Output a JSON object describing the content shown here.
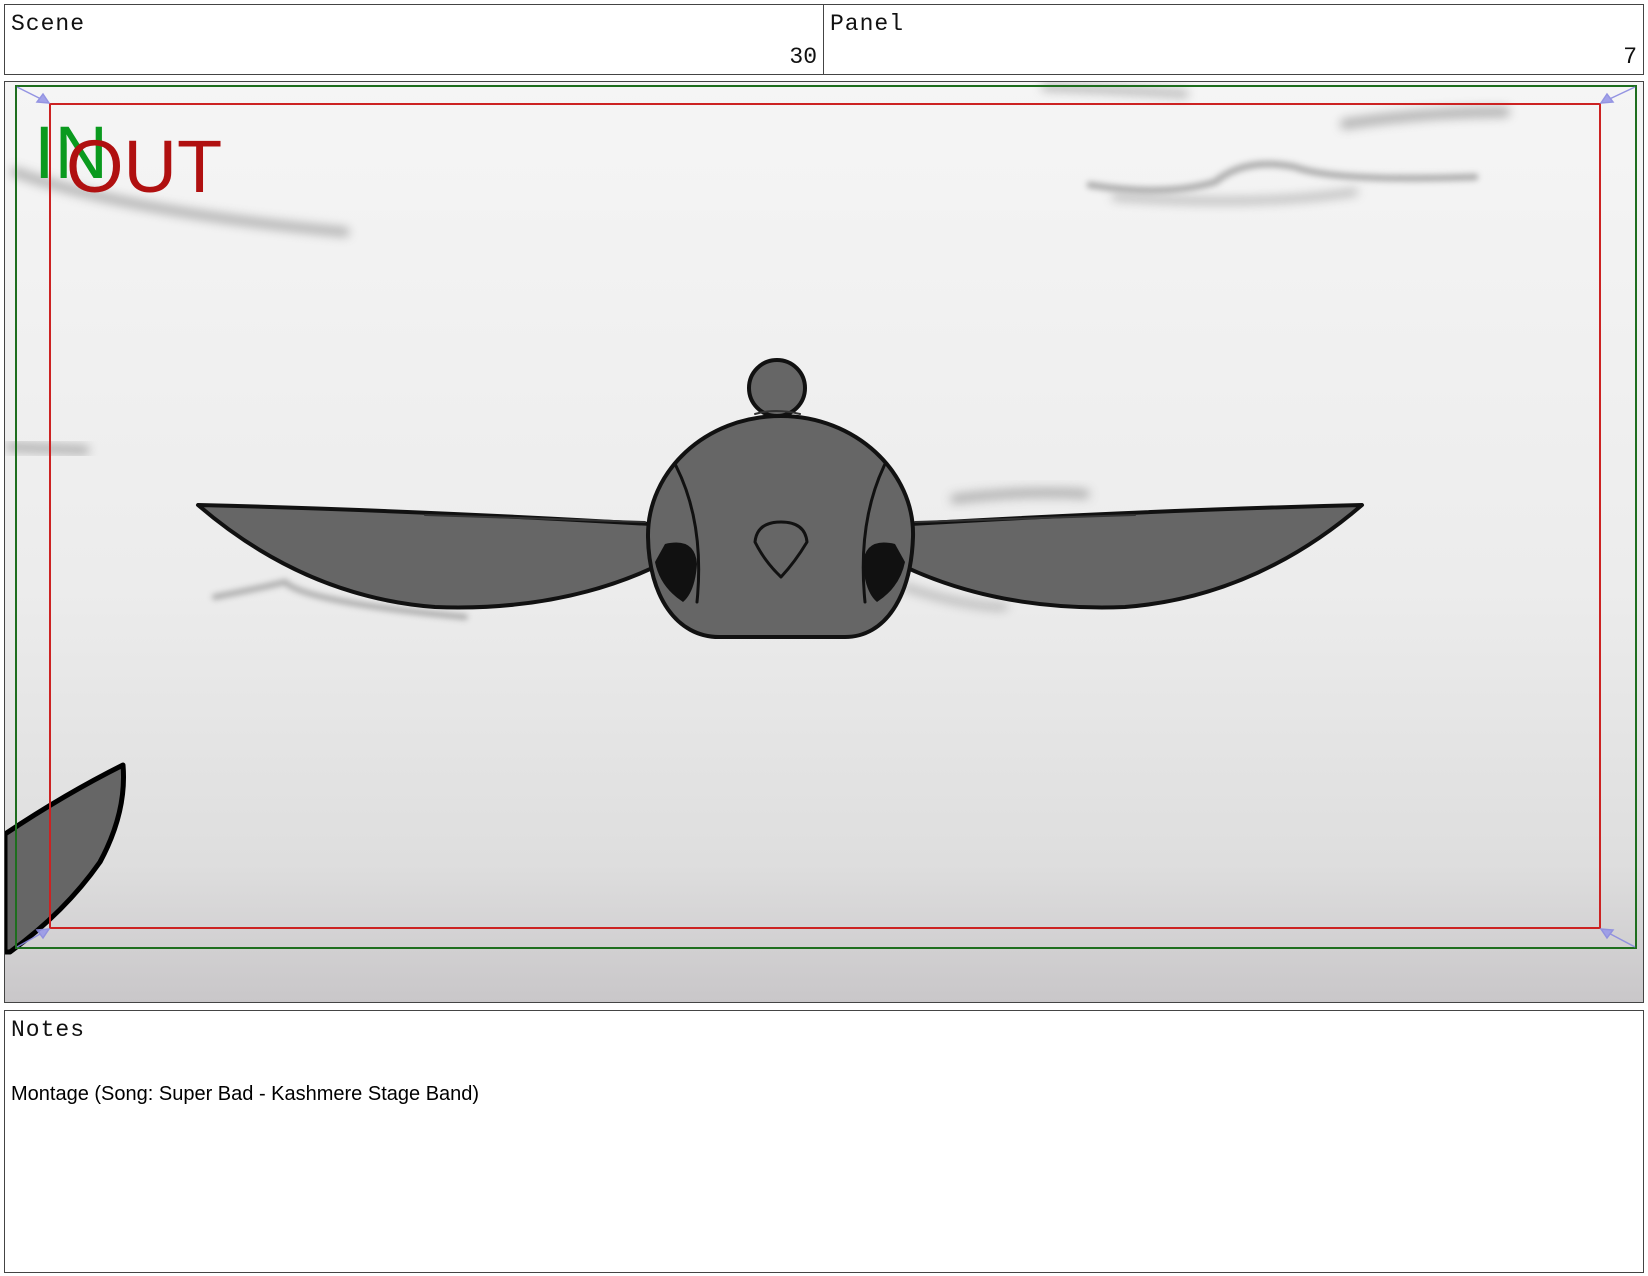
{
  "header": {
    "scene_label": "Scene",
    "scene_value": "30",
    "panel_label": "Panel",
    "panel_value": "7"
  },
  "frame": {
    "in_label": "IN",
    "out_label": "OUT",
    "in_color": "#0a9a1e",
    "out_color": "#b01010",
    "safe_frame_color": "#1e6e1e",
    "action_frame_color": "#cc2222"
  },
  "notes": {
    "label": "Notes",
    "text": "Montage (Song: Super Bad - Kashmere Stage Band)"
  }
}
